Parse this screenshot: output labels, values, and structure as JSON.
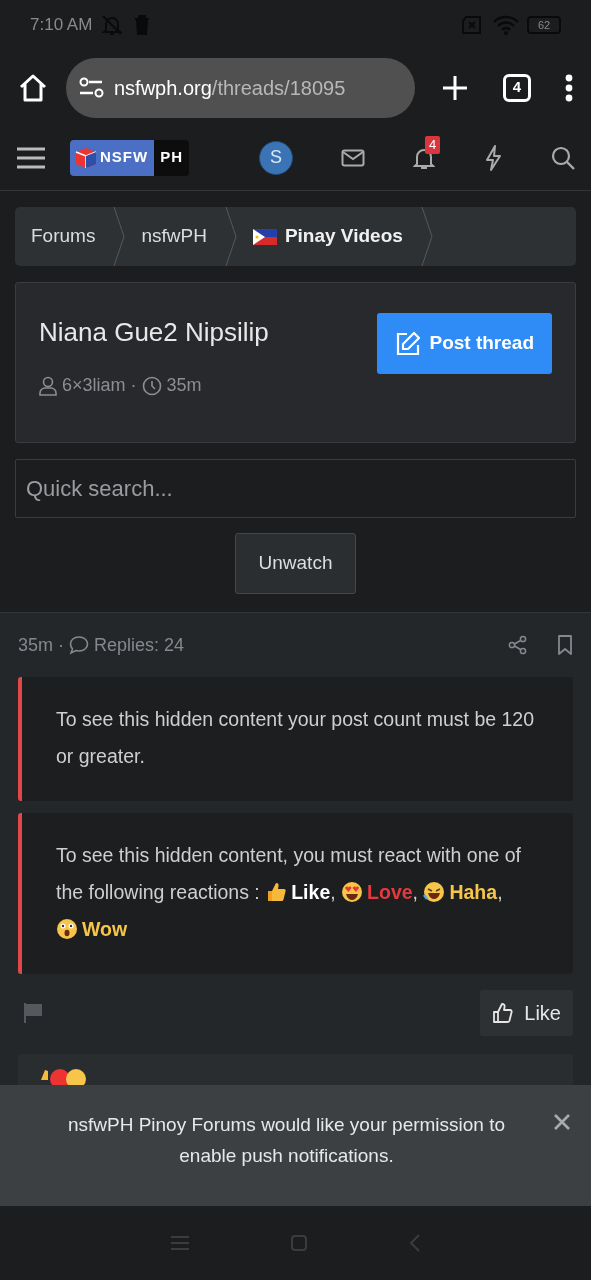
{
  "status_bar": {
    "time": "7:10 AM",
    "battery": "62"
  },
  "browser": {
    "url_host": "nsfwph.org",
    "url_path": "/threads/18095",
    "tab_count": "4"
  },
  "site_header": {
    "logo_left": "NSFW",
    "logo_right": "PH",
    "avatar_letter": "S",
    "alert_count": "4"
  },
  "breadcrumbs": [
    {
      "label": "Forums",
      "kind": "plain"
    },
    {
      "label": "nsfwPH",
      "kind": "plain"
    },
    {
      "label": "Pinay Videos",
      "kind": "flagged"
    }
  ],
  "thread": {
    "title": "Niana Gue2 Nipsilip",
    "author": "6×3liam",
    "separator": "·",
    "age": "35m",
    "post_button": "Post thread"
  },
  "search": {
    "placeholder": "Quick search..."
  },
  "watch_button": "Unwatch",
  "post": {
    "age": "35m",
    "separator": "·",
    "replies": "Replies: 24",
    "hidden_blocks": [
      {
        "kind": "text",
        "text": "To see this hidden content your post count must be 120 or greater."
      },
      {
        "kind": "reactions",
        "text": "To see this hidden content, you must react with one of the following reactions :",
        "reactions": [
          {
            "kind": "like",
            "label": "Like",
            "color": "#ffffff",
            "separator": ","
          },
          {
            "kind": "love",
            "label": "Love",
            "color": "#e8383d",
            "separator": ","
          },
          {
            "kind": "haha",
            "label": "Haha",
            "color": "#f6c549",
            "separator": ","
          },
          {
            "kind": "wow",
            "label": "Wow",
            "color": "#f6c549"
          }
        ]
      }
    ],
    "like_button": "Like"
  },
  "notification": {
    "text": "nsfwPH Pinoy Forums would like your permission to enable push notifications."
  }
}
